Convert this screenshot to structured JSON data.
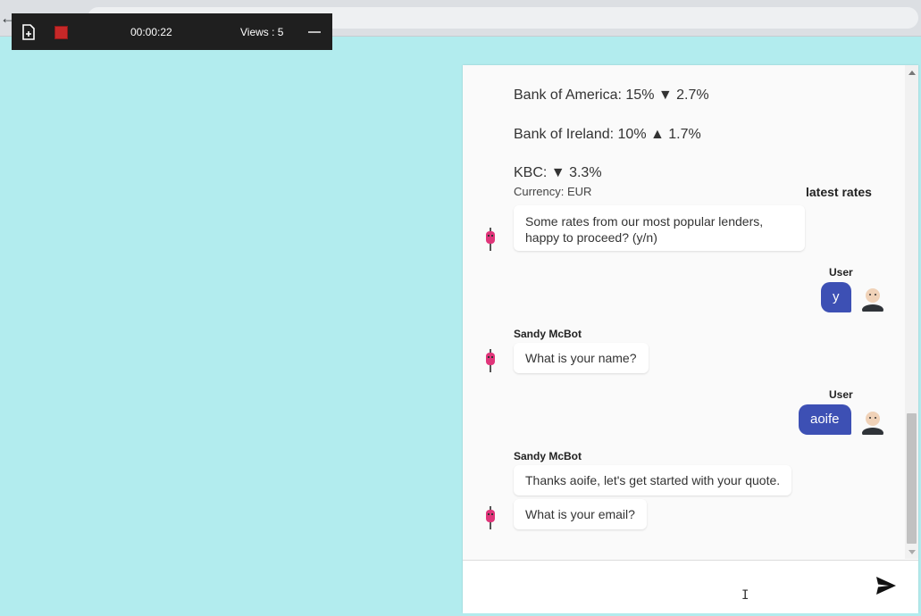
{
  "recorder": {
    "timer": "00:00:22",
    "views": "Views : 5"
  },
  "chat": {
    "rates": [
      "Bank of America: 15% ▼ 2.7%",
      "Bank of Ireland: 10% ▲ 1.7%",
      "KBC: ▼ 3.3%"
    ],
    "currency": "Currency: EUR",
    "card_title": "latest rates",
    "messages": [
      {
        "sender": "",
        "text": "Some rates from our most popular lenders, happy to proceed? (y/n)"
      },
      {
        "sender": "User",
        "text": "y"
      },
      {
        "sender": "Sandy McBot",
        "text": "What is your name?"
      },
      {
        "sender": "User",
        "text": "aoife"
      },
      {
        "sender": "Sandy McBot",
        "text": "Thanks aoife, let's get started with your quote."
      },
      {
        "sender": "",
        "text": "What is your email?"
      }
    ]
  },
  "input": {
    "value": "",
    "placeholder": ""
  },
  "colors": {
    "page_bg": "#b2ecee",
    "user_bubble": "#3d50b4",
    "bot_avatar": "#e0357a"
  },
  "icons": [
    "record-icon",
    "stop-icon",
    "minimize-icon",
    "bot-avatar-icon",
    "user-avatar-icon",
    "send-icon"
  ]
}
